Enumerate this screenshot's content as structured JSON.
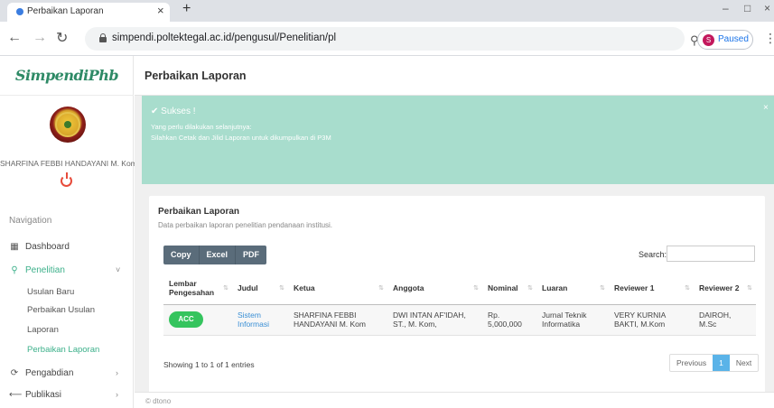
{
  "browser": {
    "tab_title": "Perbaikan Laporan",
    "tab_close": "×",
    "new_tab": "+",
    "url": "simpendi.poltektegal.ac.id/pengusul/Penelitian/pl",
    "profile_initial": "S",
    "profile_status": "Paused",
    "win_min": "–",
    "win_max": "□",
    "win_close": "×"
  },
  "sidebar": {
    "brand": "SimpendiPhb",
    "user_name": "SHARFINA FEBBI HANDAYANI M. Kom",
    "nav_header": "Navigation",
    "items": [
      {
        "label": "Dashboard",
        "icon": "grid-icon"
      },
      {
        "label": "Penelitian",
        "icon": "search-icon",
        "chevron": "˅"
      },
      {
        "label": "Pengabdian",
        "icon": "cycle-icon",
        "chevron": "›"
      },
      {
        "label": "Publikasi",
        "icon": "share-icon",
        "chevron": "›"
      }
    ],
    "sub_items": [
      "Usulan Baru",
      "Perbaikan Usulan",
      "Laporan",
      "Perbaikan Laporan"
    ]
  },
  "header": {
    "title": "Perbaikan Laporan"
  },
  "alert": {
    "title": "✔ Sukses !",
    "line1": "Yang perlu dilakukan selanjutnya:",
    "line2": "Silahkan Cetak dan Jilid Laporan untuk dikumpulkan di P3M",
    "close": "×"
  },
  "card": {
    "title": "Perbaikan Laporan",
    "subtitle": "Data perbaikan laporan penelitian pendanaan institusi.",
    "buttons": {
      "copy": "Copy",
      "excel": "Excel",
      "pdf": "PDF"
    },
    "search_label": "Search:",
    "search_value": "",
    "columns": [
      "Lembar Pengesahan",
      "Judul",
      "Ketua",
      "Anggota",
      "Nominal",
      "Luaran",
      "Reviewer 1",
      "Reviewer 2"
    ],
    "row": {
      "lembar": "ACC",
      "judul": "Sistem Informasi",
      "ketua": "SHARFINA FEBBI HANDAYANI M. Kom",
      "anggota": "DWI INTAN AF'IDAH, ST., M. Kom,",
      "nominal": "Rp. 5,000,000",
      "luaran": "Jurnal Teknik Informatika",
      "reviewer1": "VERY KURNIA BAKTI, M.Kom",
      "reviewer2": "DAIROH, M.Sc"
    },
    "showing": "Showing 1 to 1 of 1 entries",
    "pager": {
      "previous": "Previous",
      "page": "1",
      "next": "Next"
    }
  },
  "footer": {
    "text": "© dtono"
  },
  "colors": {
    "brand": "#2e8a66",
    "accent": "#3cb08a",
    "alert_bg": "#a8ddcd",
    "acc_badge": "#35c45e",
    "link": "#3a8fd5",
    "button_bg": "#5a6c7a"
  }
}
